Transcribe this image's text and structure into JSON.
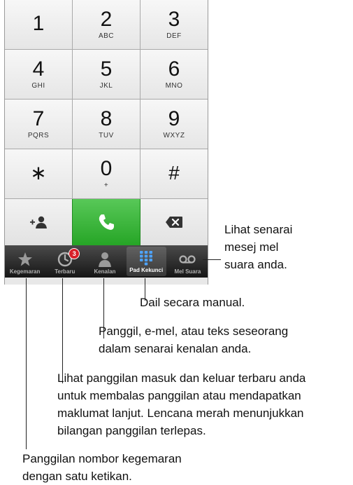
{
  "keypad": {
    "rows": [
      [
        {
          "digit": "1",
          "letters": ""
        },
        {
          "digit": "2",
          "letters": "ABC"
        },
        {
          "digit": "3",
          "letters": "DEF"
        }
      ],
      [
        {
          "digit": "4",
          "letters": "GHI"
        },
        {
          "digit": "5",
          "letters": "JKL"
        },
        {
          "digit": "6",
          "letters": "MNO"
        }
      ],
      [
        {
          "digit": "7",
          "letters": "PQRS"
        },
        {
          "digit": "8",
          "letters": "TUV"
        },
        {
          "digit": "9",
          "letters": "WXYZ"
        }
      ],
      [
        {
          "digit": "∗",
          "letters": ""
        },
        {
          "digit": "0",
          "letters": "+"
        },
        {
          "digit": "#",
          "letters": ""
        }
      ]
    ]
  },
  "actions": {
    "add_contact_icon": "add-contact-icon",
    "call_icon": "phone-icon",
    "delete_icon": "backspace-icon",
    "call_color": "#2fb12f"
  },
  "tabbar": {
    "tabs": [
      {
        "label": "Kegemaran",
        "icon": "star-icon"
      },
      {
        "label": "Terbaru",
        "icon": "clock-icon",
        "badge": "3"
      },
      {
        "label": "Kenalan",
        "icon": "person-icon"
      },
      {
        "label": "Pad Kekunci",
        "icon": "keypad-icon",
        "active": true
      },
      {
        "label": "Mel Suara",
        "icon": "voicemail-icon"
      }
    ],
    "badge_color": "#d8202a"
  },
  "callouts": {
    "voicemail": [
      "Lihat senarai",
      "mesej mel",
      "suara anda."
    ],
    "keypad": "Dail secara manual.",
    "contacts": [
      "Panggil, e-mel, atau teks seseorang",
      "dalam senarai kenalan anda."
    ],
    "recents": [
      "Lihat panggilan masuk dan keluar terbaru anda",
      "untuk membalas panggilan atau mendapatkan",
      "maklumat lanjut. Lencana merah menunjukkan",
      "bilangan panggilan terlepas."
    ],
    "favorites": [
      "Panggilan nombor kegemaran",
      "dengan satu ketikan."
    ]
  }
}
